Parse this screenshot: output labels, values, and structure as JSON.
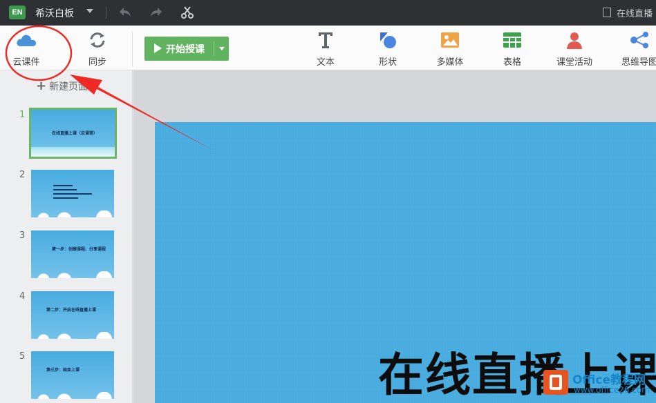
{
  "titlebar": {
    "logo_text": "EN",
    "app_name": "希沃白板",
    "doc_title": "在线直播"
  },
  "toolbar": {
    "cloud_label": "云课件",
    "sync_label": "同步",
    "start_label": "开始授课",
    "tools": [
      {
        "label": "文本",
        "icon": "text-icon"
      },
      {
        "label": "形状",
        "icon": "shape-icon"
      },
      {
        "label": "多媒体",
        "icon": "media-icon"
      },
      {
        "label": "表格",
        "icon": "table-icon"
      },
      {
        "label": "课堂活动",
        "icon": "activity-icon"
      },
      {
        "label": "思维导图",
        "icon": "mindmap-icon"
      }
    ]
  },
  "sidebar": {
    "new_page_label": "新建页面",
    "pages": [
      {
        "num": "1",
        "title": "在线直播上课（云课堂）"
      },
      {
        "num": "2",
        "title": ""
      },
      {
        "num": "3",
        "title": "第一步：创建课程、分享课程"
      },
      {
        "num": "4",
        "title": "第二步：开启在线直播上课"
      },
      {
        "num": "5",
        "title": "第三步：结束上课"
      }
    ]
  },
  "slide": {
    "title": "在线直播上课"
  },
  "watermark": {
    "line1": "Office教程网",
    "line2": "www.office26.com"
  },
  "colors": {
    "accent_green": "#62b35f",
    "annotation_red": "#ee2a24",
    "slide_blue": "#48acdf"
  }
}
